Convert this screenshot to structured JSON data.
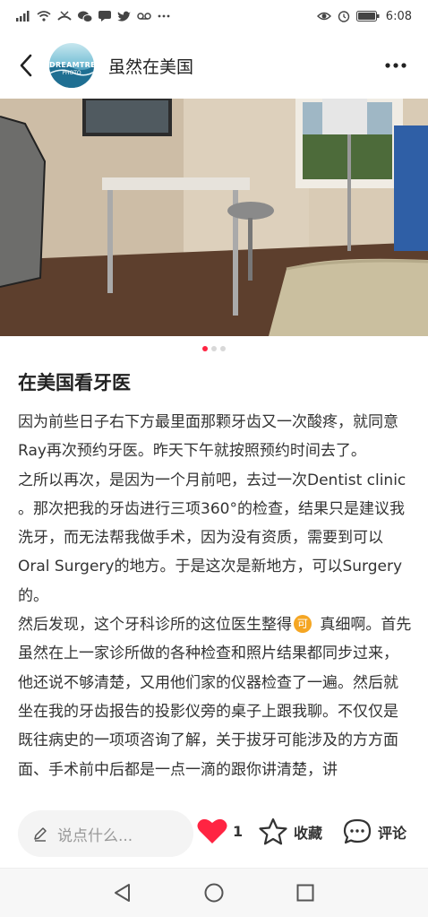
{
  "status_bar": {
    "time": "6:08",
    "left_icons": [
      "signal-icon",
      "wifi-icon",
      "missed-call-icon",
      "wechat-icon",
      "message-icon",
      "twitter-icon",
      "voicemail-icon",
      "more-dots-icon"
    ],
    "right_icons": [
      "eye-icon",
      "alarm-icon",
      "battery-icon"
    ]
  },
  "header": {
    "title": "虽然在美国",
    "avatar_text": "DREAMTRE",
    "avatar_sub": "PHOTO"
  },
  "carousel": {
    "slide_count": 3,
    "active_index": 0
  },
  "post": {
    "title": "在美国看牙医",
    "paragraphs": [
      "因为前些日子右下方最里面那颗牙齿又一次酸疼，就同意Ray再次预约牙医。昨天下午就按照预约时间去了。",
      "之所以再次，是因为一个月前吧，去过一次Dentist clinic 。那次把我的牙齿进行三项360°的检查，结果只是建议我洗牙，而无法帮我做手术，因为没有资质，需要到可以Oral Surgery的地方。于是这次是新地方，可以Surgery的。"
    ],
    "p3_before": "然后发现，这个牙科诊所的这位医生整得",
    "p3_emoji": "可",
    "p3_after": " 真细啊。首先虽然在上一家诊所做的各种检查和照片结果都同步过来，他还说不够清楚，又用他们家的仪器检查了一遍。然后就坐在我的牙齿报告的投影仪旁的桌子上跟我聊。不仅仅是既往病史的一项项咨询了解，关于拔牙可能涉及的方方面面、手术前中后都是一点一滴的跟你讲清楚，讲"
  },
  "bottom_bar": {
    "comment_placeholder": "说点什么...",
    "like_count": "1",
    "collect_label": "收藏",
    "comment_label": "评论",
    "like_color": "#ff2442"
  },
  "nav_bar": {
    "buttons": [
      "back-triangle-icon",
      "home-circle-icon",
      "recents-square-icon"
    ]
  }
}
